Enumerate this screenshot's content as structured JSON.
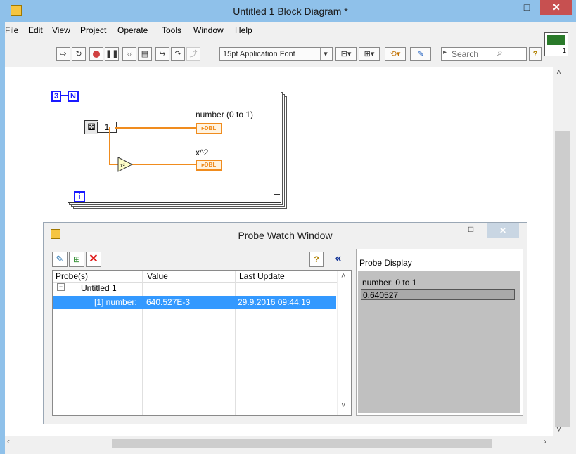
{
  "window": {
    "title": "Untitled 1 Block Diagram *",
    "controls": {
      "minimize": "–",
      "maximize": "□",
      "close": "✕"
    }
  },
  "menu": [
    "File",
    "Edit",
    "View",
    "Project",
    "Operate",
    "Tools",
    "Window",
    "Help"
  ],
  "toolbar": {
    "font": "15pt Application Font",
    "search_placeholder": "Search",
    "help": "?"
  },
  "diagram": {
    "loop_count": "3",
    "loop_n": "N",
    "iteration": "i",
    "random_constant": "1",
    "indicator1_label": "number (0 to 1)",
    "indicator2_label": "x^2",
    "indicator_type": "▸DBL",
    "square_glyph": "x²"
  },
  "probe_window": {
    "title": "Probe Watch Window",
    "columns": [
      "Probe(s)",
      "Value",
      "Last Update"
    ],
    "tree_root": "Untitled 1",
    "rows": [
      {
        "probe": "[1] number:",
        "value": "640.527E-3",
        "updated": "29.9.2016 09:44:19"
      }
    ],
    "display_title": "Probe Display",
    "display_label": "number: 0 to 1",
    "display_value": "0.640527",
    "collapse_btn": "«",
    "help": "?"
  }
}
